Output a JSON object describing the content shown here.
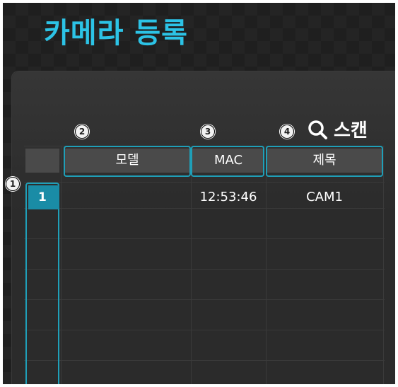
{
  "title": "카메라 등록",
  "scan": {
    "label": "스캔",
    "icon": "search-icon"
  },
  "callouts": [
    "1",
    "2",
    "3",
    "4"
  ],
  "columns": {
    "model": "모델",
    "mac": "MAC",
    "name": "제목"
  },
  "rows": [
    {
      "number": "1",
      "model": "",
      "mac": "12:53:46",
      "name": "CAM1"
    }
  ],
  "colors": {
    "accent": "#2cc3e6",
    "highlight": "#1f9fb8",
    "selected_row": "#1a8ca6"
  }
}
